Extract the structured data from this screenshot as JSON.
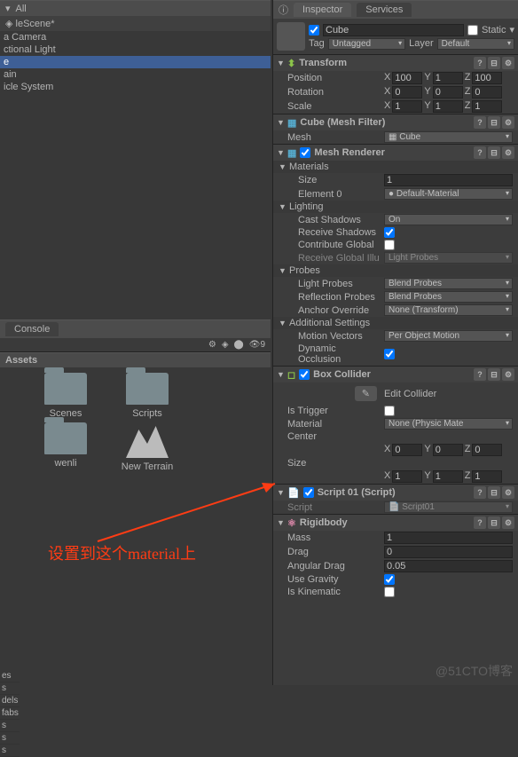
{
  "hierarchy": {
    "filter": "All",
    "scene": "leScene*",
    "items": [
      "a Camera",
      "ctional Light",
      "e",
      "ain",
      "icle System"
    ],
    "selected_index": 2
  },
  "console": {
    "title": "Console",
    "count": "9"
  },
  "assets": {
    "title": "Assets",
    "sidebar": [
      "es",
      "s",
      "dels",
      "fabs",
      "s",
      "s",
      "s"
    ],
    "items": [
      {
        "name": "Scenes",
        "type": "folder"
      },
      {
        "name": "Scripts",
        "type": "folder"
      },
      {
        "name": "wenli",
        "type": "folder"
      },
      {
        "name": "New Terrain",
        "type": "terrain"
      }
    ]
  },
  "inspector": {
    "tabs": [
      "Inspector",
      "Services"
    ],
    "object": {
      "name": "Cube",
      "static_label": "Static",
      "static": false,
      "tag_label": "Tag",
      "tag": "Untagged",
      "layer_label": "Layer",
      "layer": "Default"
    },
    "transform": {
      "title": "Transform",
      "position": {
        "label": "Position",
        "x": "100",
        "y": "1",
        "z": "100"
      },
      "rotation": {
        "label": "Rotation",
        "x": "0",
        "y": "0",
        "z": "0"
      },
      "scale": {
        "label": "Scale",
        "x": "1",
        "y": "1",
        "z": "1"
      }
    },
    "mesh_filter": {
      "title": "Cube (Mesh Filter)",
      "mesh_label": "Mesh",
      "mesh": "Cube"
    },
    "mesh_renderer": {
      "title": "Mesh Renderer",
      "materials": {
        "header": "Materials",
        "size_label": "Size",
        "size": "1",
        "element0_label": "Element 0",
        "element0": "Default-Material"
      },
      "lighting": {
        "header": "Lighting",
        "cast_label": "Cast Shadows",
        "cast": "On",
        "receive_label": "Receive Shadows",
        "contribute_label": "Contribute Global",
        "receive_gi_label": "Receive Global Illu",
        "receive_gi": "Light Probes"
      },
      "probes": {
        "header": "Probes",
        "light_label": "Light Probes",
        "light": "Blend Probes",
        "reflection_label": "Reflection Probes",
        "reflection": "Blend Probes",
        "anchor_label": "Anchor Override",
        "anchor": "None (Transform)"
      },
      "additional": {
        "header": "Additional Settings",
        "motion_label": "Motion Vectors",
        "motion": "Per Object Motion",
        "occlusion_label": "Dynamic Occlusion"
      }
    },
    "box_collider": {
      "title": "Box Collider",
      "edit_label": "Edit Collider",
      "trigger_label": "Is Trigger",
      "material_label": "Material",
      "material": "None (Physic Mate",
      "center_label": "Center",
      "center": {
        "x": "0",
        "y": "0",
        "z": "0"
      },
      "size_label": "Size",
      "size": {
        "x": "1",
        "y": "1",
        "z": "1"
      }
    },
    "script": {
      "title": "Script 01 (Script)",
      "script_label": "Script",
      "script": "Script01"
    },
    "rigidbody": {
      "title": "Rigidbody",
      "mass_label": "Mass",
      "mass": "1",
      "drag_label": "Drag",
      "drag": "0",
      "angular_label": "Angular Drag",
      "angular": "0.05",
      "gravity_label": "Use Gravity",
      "kinematic_label": "Is Kinematic"
    }
  },
  "annotation": "设置到这个material上",
  "watermark": "@51CTO博客"
}
